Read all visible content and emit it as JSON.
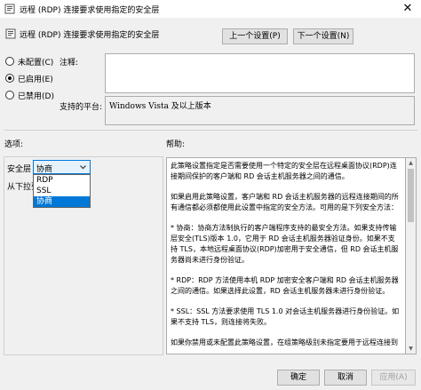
{
  "window": {
    "title": "远程 (RDP) 连接要求使用指定的安全层"
  },
  "header": {
    "title": "远程 (RDP) 连接要求使用指定的安全层",
    "prev_button": "上一个设置(P)",
    "next_button": "下一个设置(N)"
  },
  "state": {
    "options": [
      {
        "label": "未配置(C)",
        "checked": false
      },
      {
        "label": "已启用(E)",
        "checked": true
      },
      {
        "label": "已禁用(D)",
        "checked": false
      }
    ]
  },
  "comment": {
    "label": "注释:",
    "value": ""
  },
  "supported": {
    "label": "支持的平台:",
    "value": "Windows Vista 及以上版本"
  },
  "options_section": {
    "label": "选项:",
    "security_layer_label": "安全层",
    "selected": "协商",
    "dropdown_items": [
      "RDP",
      "SSL",
      "协商"
    ],
    "partial_label": "从下拉列"
  },
  "help": {
    "label": "帮助:",
    "paragraphs": [
      "此策略设置指定是否需要使用一个特定的安全层在远程桌面协议(RDP)连接期间保护的客户端和 RD 会话主机服务器之间的通信。",
      "如果启用此策略设置，客户端和 RD 会话主机服务器的远程连接期间的所有通信都必须都使用此设置中指定的安全方法。可用的是下列安全方法：",
      "* 协商：协商方法制执行的客户端程序支持的最安全方法。如果支持传输层安全(TLS)版本 1.0，它用于 RD 会话主机服务器验证身份。如果不支持 TLS，本地远程桌面协议(RDP)加密用于安全通信，但 RD 会话主机服务器尚未进行身份验证。",
      "* RDP：RDP 方法使用本机 RDP 加密安全客户端和 RD 会话主机服务器之间的通信。如果选择此设置，RD 会话主机服务器未进行身份验证。",
      "* SSL：SSL 方法要求使用 TLS 1.0 对会话主机服务器进行身份验证。如果不支持 TLS，则连接将失败。",
      "如果你禁用或未配置此策略设置，在组策略级别未指定要用于远程连接到"
    ]
  },
  "footer": {
    "ok": "确定",
    "cancel": "取消",
    "apply": "应用(A)"
  }
}
